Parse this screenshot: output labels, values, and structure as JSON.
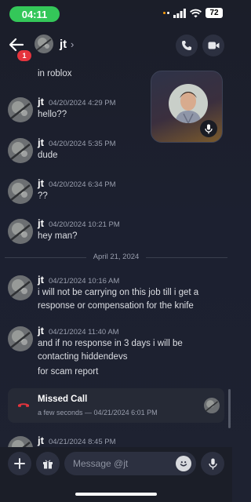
{
  "status": {
    "time": "04:11",
    "battery": "72"
  },
  "header": {
    "name": "jt",
    "chevron": "›",
    "unread_badge": "1"
  },
  "messages": [
    {
      "text": "in roblox"
    },
    {
      "author": "jt",
      "time": "04/20/2024 4:29 PM",
      "text": "hello??"
    },
    {
      "author": "jt",
      "time": "04/20/2024 5:35 PM",
      "text": "dude"
    },
    {
      "author": "jt",
      "time": "04/20/2024 6:34 PM",
      "text": "??"
    },
    {
      "author": "jt",
      "time": "04/20/2024 10:21 PM",
      "text": "hey man?"
    },
    {
      "author": "jt",
      "time": "04/21/2024 10:16 AM",
      "text": "i will not be carrying on this job till i get a response or compensation for the knife"
    },
    {
      "author": "jt",
      "time": "04/21/2024 11:40 AM",
      "text": "and if no response in 3 days i will be contacting hiddendevs",
      "text2": "for scam report"
    },
    {
      "author": "jt",
      "time": "04/21/2024 8:45 PM"
    }
  ],
  "date_divider": "April 21, 2024",
  "missed_call": {
    "title": "Missed Call",
    "subtitle": "a few seconds — 04/21/2024 6:01 PM"
  },
  "composer": {
    "placeholder": "Message @jt"
  },
  "icons": [
    "back-arrow-icon",
    "phone-icon",
    "video-camera-icon",
    "phone-hangup-icon",
    "plus-icon",
    "gift-icon",
    "emoji-icon",
    "microphone-icon"
  ],
  "colors": {
    "accent_green": "#34c759",
    "badge_red": "#e5343d",
    "missed_call_red": "#e5343d",
    "background": "#1c2030"
  }
}
